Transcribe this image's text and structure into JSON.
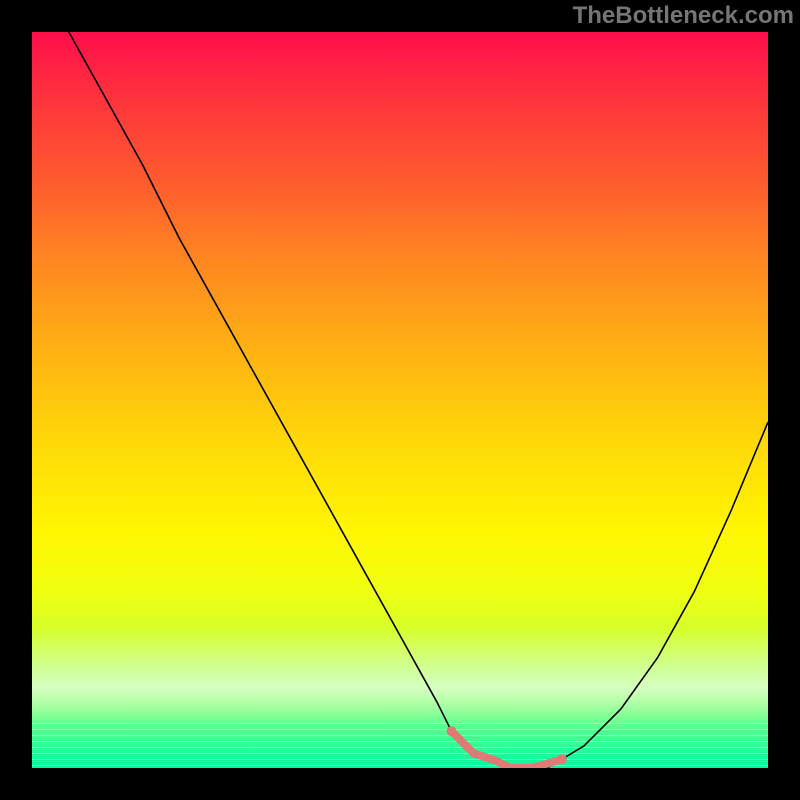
{
  "watermark": "TheBottleneck.com",
  "colors": {
    "curve": "#000000",
    "accent": "#e07a74",
    "frame": "#000000"
  },
  "chart_data": {
    "type": "line",
    "title": "",
    "xlabel": "",
    "ylabel": "",
    "xlim": [
      0,
      100
    ],
    "ylim": [
      0,
      100
    ],
    "x": [
      5,
      10,
      15,
      20,
      25,
      30,
      35,
      40,
      45,
      50,
      55,
      57,
      60,
      63,
      65,
      67,
      70,
      75,
      80,
      85,
      90,
      95,
      100
    ],
    "values": [
      100,
      91,
      82,
      72,
      63,
      54,
      45,
      36,
      27,
      18,
      9,
      5,
      2,
      1,
      0,
      0,
      0,
      3,
      8,
      15,
      24,
      35,
      47
    ],
    "accent_region_x": [
      57,
      70
    ],
    "gradient_stops": [
      {
        "pos": 0.0,
        "color": "#ff0e4c"
      },
      {
        "pos": 0.08,
        "color": "#ff2f3e"
      },
      {
        "pos": 0.2,
        "color": "#ff5a2f"
      },
      {
        "pos": 0.32,
        "color": "#ff8a20"
      },
      {
        "pos": 0.44,
        "color": "#ffb412"
      },
      {
        "pos": 0.56,
        "color": "#ffd908"
      },
      {
        "pos": 0.68,
        "color": "#fff602"
      },
      {
        "pos": 0.76,
        "color": "#f0ff10"
      },
      {
        "pos": 0.84,
        "color": "#c8ff3a"
      },
      {
        "pos": 0.9,
        "color": "#8eff6a"
      },
      {
        "pos": 0.95,
        "color": "#4dff8e"
      },
      {
        "pos": 1.0,
        "color": "#08f5a0"
      }
    ]
  }
}
